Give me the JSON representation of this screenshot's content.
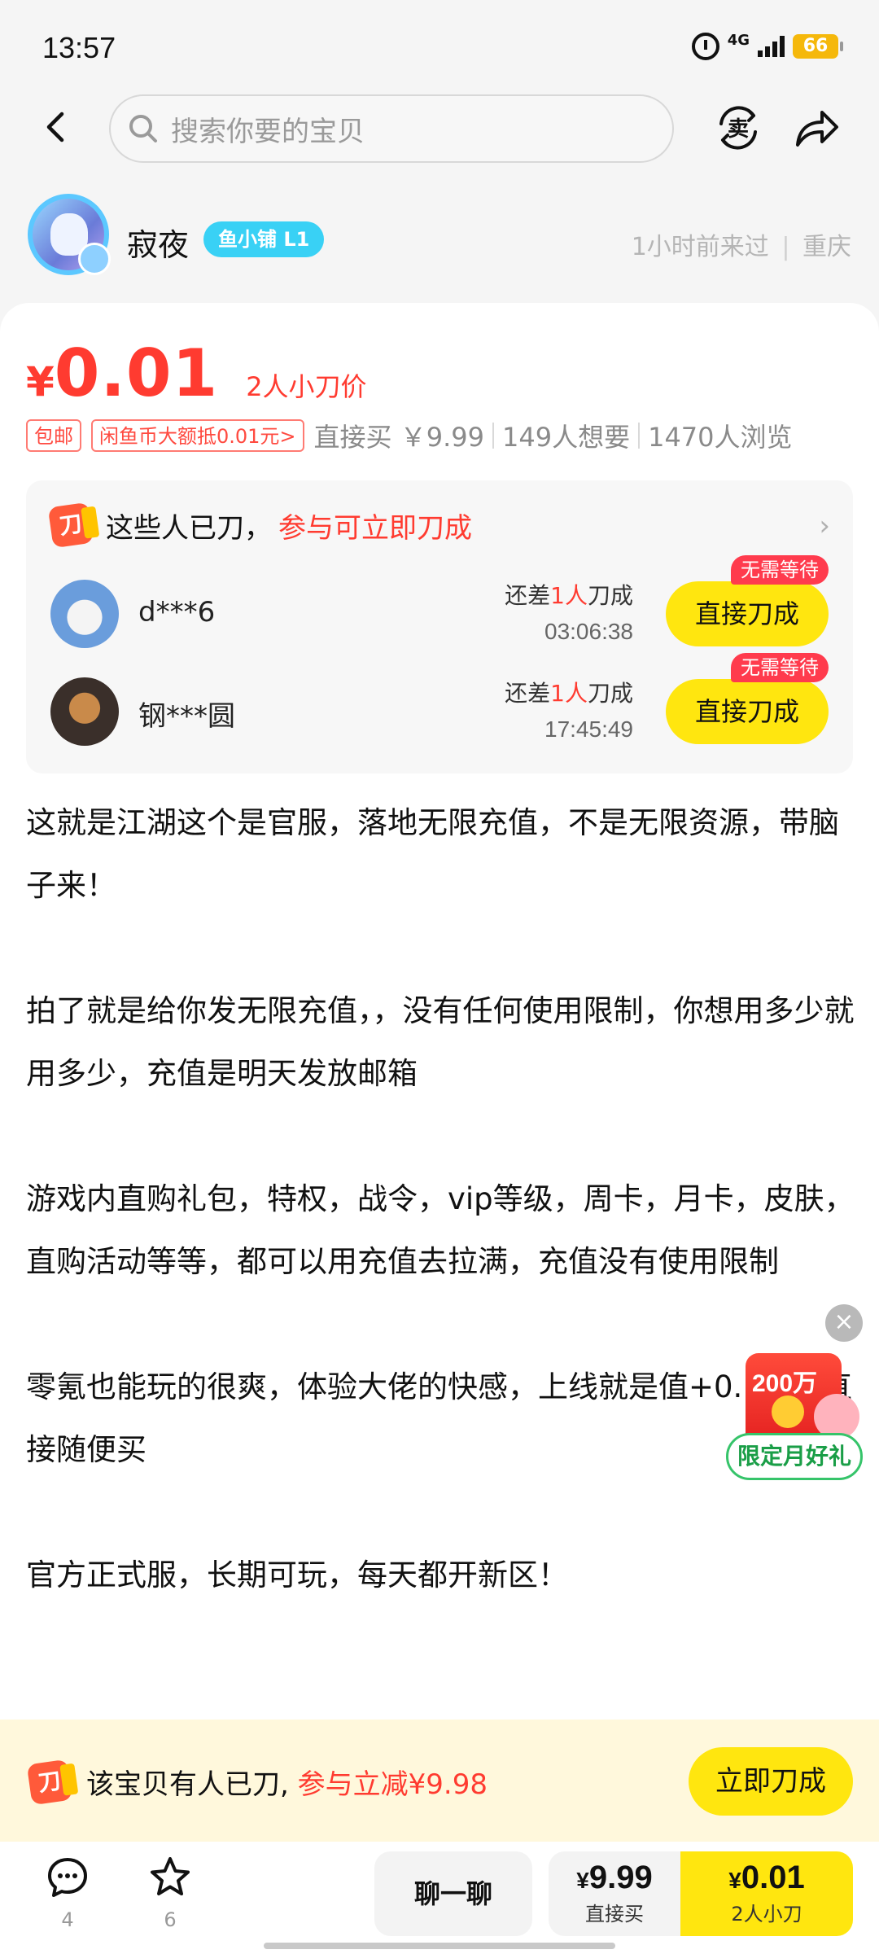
{
  "status_bar": {
    "time": "13:57",
    "network": "4G",
    "battery": "66"
  },
  "search": {
    "placeholder": "搜索你要的宝贝"
  },
  "nav": {
    "sell_label": "卖"
  },
  "seller": {
    "name": "寂夜",
    "shop_badge": "鱼小铺 L1",
    "last_seen": "1小时前来过",
    "location": "重庆"
  },
  "price": {
    "currency": "¥",
    "value": "0.01",
    "note": "2人小刀价"
  },
  "tags": [
    "包邮",
    "闲鱼币大额抵0.01元>"
  ],
  "meta": {
    "direct_buy": "直接买 ￥9.99",
    "wants": "149人想要",
    "views": "1470人浏览"
  },
  "bargain": {
    "icon_text": "刀",
    "title": "这些人已刀，",
    "title_highlight": "参与可立即刀成",
    "rows": [
      {
        "name": "d***6",
        "status_prefix": "还差",
        "status_count": "1人",
        "status_suffix": "刀成",
        "countdown": "03:06:38",
        "button": "直接刀成",
        "badge": "无需等待"
      },
      {
        "name": "钢***圆",
        "status_prefix": "还差",
        "status_count": "1人",
        "status_suffix": "刀成",
        "countdown": "17:45:49",
        "button": "直接刀成",
        "badge": "无需等待"
      }
    ]
  },
  "description": "这就是江湖这个是官服，落地无限充值，不是无限资源，带脑子来！\n\n拍了就是给你发无限充值，，没有任何使用限制，你想用多少就用多少，充值是明天发放邮箱\n\n游戏内直购礼包，特权，战令，vip等级，周卡，月卡，皮肤，直购活动等等，都可以用充值去拉满，充值没有使用限制\n\n零氪也能玩的很爽，体验大佬的快感，上线就是值+0.1折扣直接随便买\n\n官方正式服，长期可玩，每天都开新区！",
  "promo": {
    "amount": "200万",
    "label": "限定月好礼",
    "close": "×"
  },
  "banner": {
    "icon_text": "刀",
    "text": "该宝贝有人已刀, ",
    "highlight": "参与立减¥9.98",
    "button": "立即刀成"
  },
  "bottom_bar": {
    "comments_count": "4",
    "favorites_count": "6",
    "chat_label": "聊一聊",
    "direct_price_symbol": "¥",
    "direct_price": "9.99",
    "direct_label": "直接买",
    "cut_price_symbol": "¥",
    "cut_price": "0.01",
    "cut_label": "2人小刀"
  },
  "colors": {
    "accent_red": "#ff3b30",
    "accent_yellow": "#ffe60f",
    "shop_badge": "#39d1f5",
    "banner_bg": "#fff8dc"
  }
}
